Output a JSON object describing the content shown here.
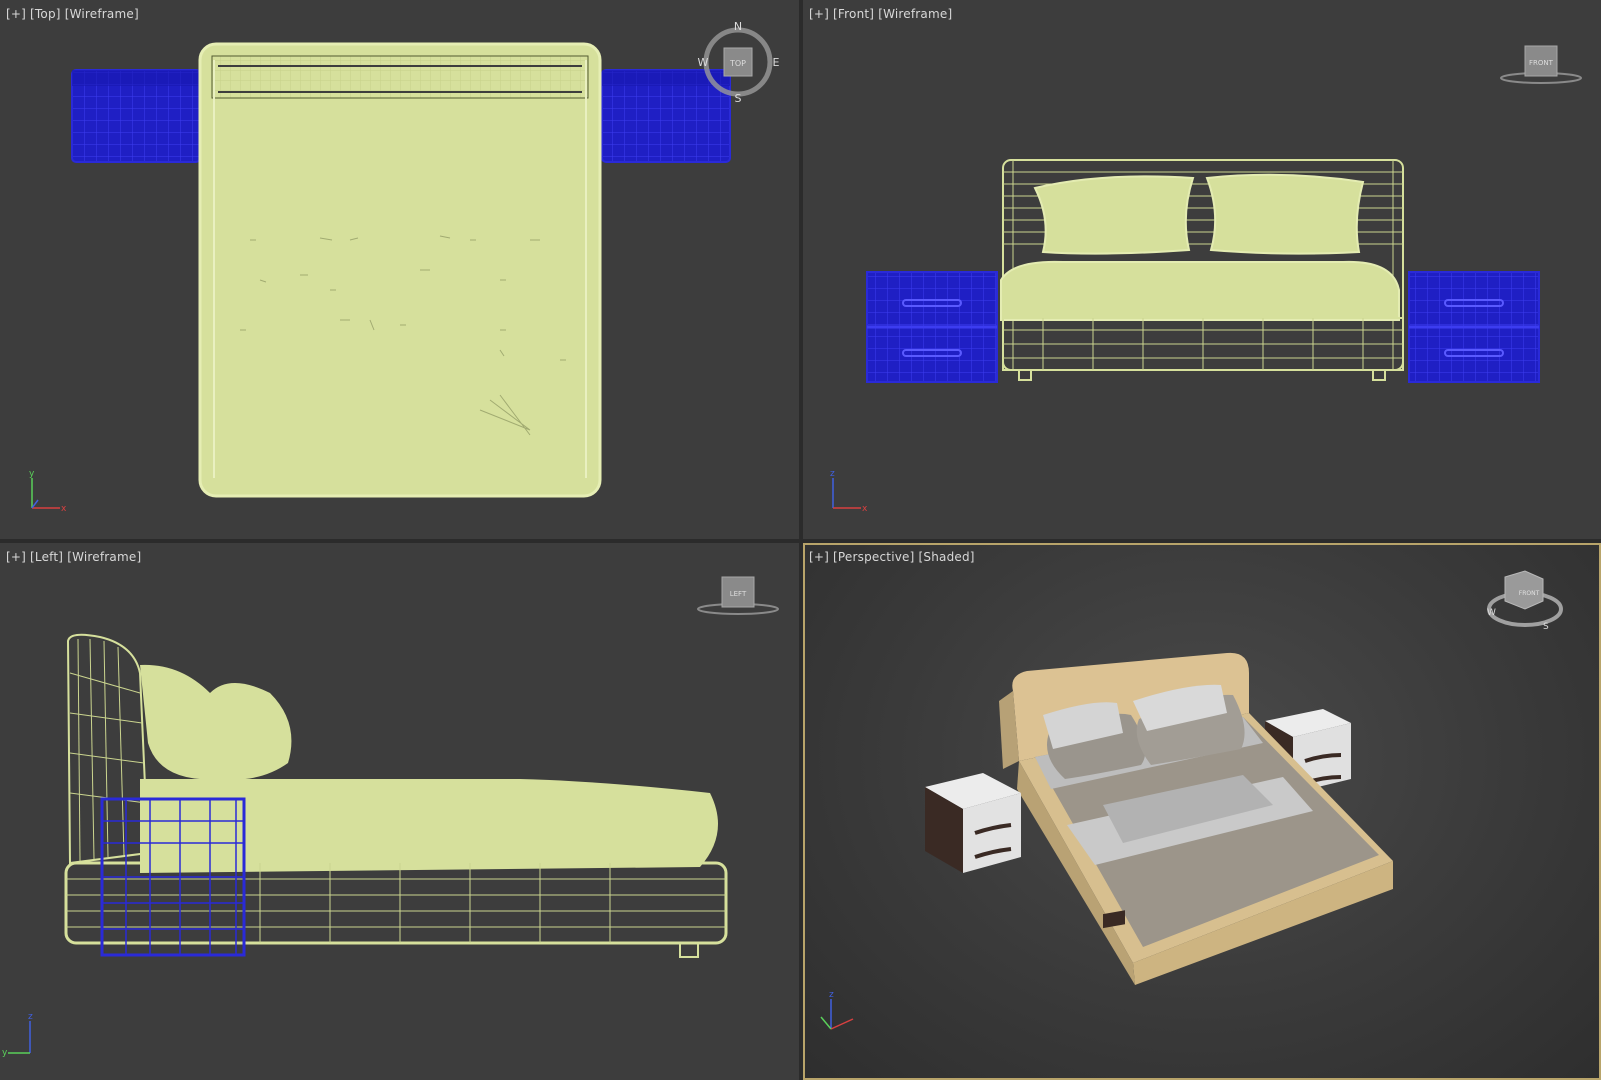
{
  "viewports": {
    "top": {
      "label_plus": "[+]",
      "label_view": "[Top]",
      "label_mode": "[Wireframe]",
      "compass": {
        "n": "N",
        "s": "S",
        "e": "E",
        "w": "W",
        "cube": "TOP"
      }
    },
    "front": {
      "label_plus": "[+]",
      "label_view": "[Front]",
      "label_mode": "[Wireframe]",
      "cube": "FRONT"
    },
    "left": {
      "label_plus": "[+]",
      "label_view": "[Left]",
      "label_mode": "[Wireframe]",
      "cube": "LEFT"
    },
    "perspective": {
      "label_plus": "[+]",
      "label_view": "[Perspective]",
      "label_mode": "[Shaded]",
      "cube": "FRONT",
      "compass": {
        "w": "W",
        "s": "S"
      },
      "active": true
    }
  },
  "axes": {
    "x": "x",
    "y": "y",
    "z": "z"
  },
  "colors": {
    "viewport_bg": "#3d3d3d",
    "bed_wire": "#d9e3a0",
    "nightstand_wire": "#1a1ab8",
    "active_border": "#b8a46a",
    "label_text": "#d8d8d8"
  }
}
